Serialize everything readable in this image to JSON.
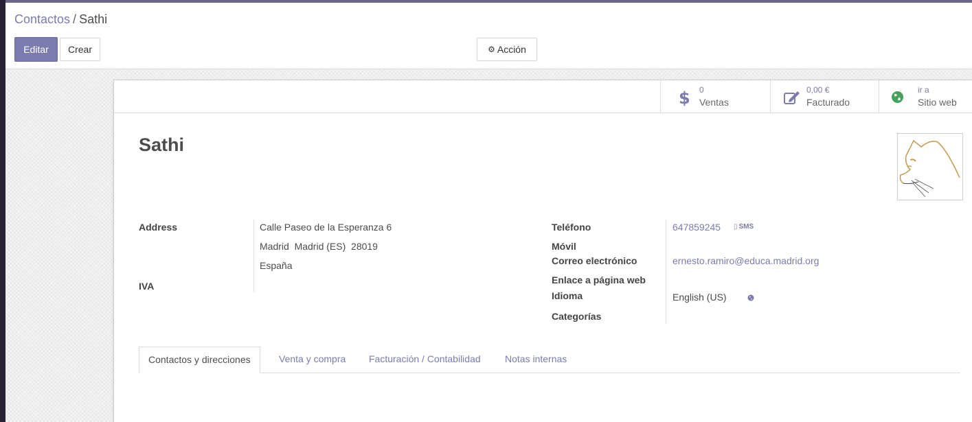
{
  "breadcrumb": {
    "parent": "Contactos",
    "separator": "/",
    "current": "Sathi"
  },
  "toolbar": {
    "edit_label": "Editar",
    "create_label": "Crear",
    "action_label": "Acción"
  },
  "stats": {
    "sales": {
      "value": "0",
      "label": "Ventas",
      "icon": "dollar-icon"
    },
    "invoiced": {
      "value": "0,00 €",
      "label": "Facturado",
      "icon": "edit-icon"
    },
    "website": {
      "value": "ir a",
      "label": "Sitio web",
      "icon": "globe-icon"
    }
  },
  "contact": {
    "name": "Sathi",
    "labels": {
      "address": "Address",
      "vat": "IVA",
      "phone": "Teléfono",
      "mobile": "Móvil",
      "email": "Correo electrónico",
      "website": "Enlace a página web",
      "language": "Idioma",
      "categories": "Categorías"
    },
    "address": {
      "street": "Calle Paseo de la Esperanza 6",
      "city_line": "Madrid  Madrid (ES)  28019",
      "country": "España"
    },
    "phone": "647859245",
    "sms_label": "SMS",
    "email": "ernesto.ramiro@educa.madrid.org",
    "language": "English (US)"
  },
  "tabs": [
    "Contactos y direcciones",
    "Venta y compra",
    "Facturación / Contabilidad",
    "Notas internas"
  ],
  "colors": {
    "accent": "#7c7bad",
    "header": "#6e6689",
    "text": "#4c4c4c"
  }
}
